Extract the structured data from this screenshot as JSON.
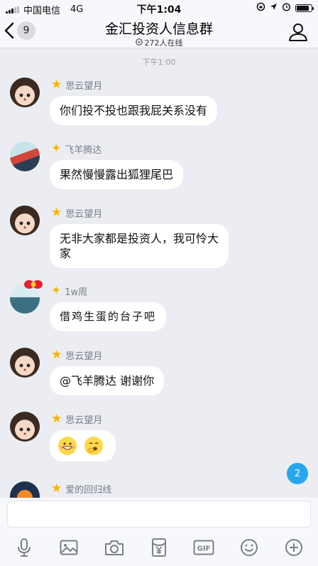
{
  "status_bar": {
    "carrier": "中国电信",
    "network": "4G",
    "time": "下午1:04",
    "battery_level": 0.85
  },
  "header": {
    "back_count": "9",
    "title": "金汇投资人信息群",
    "online": "272人在线"
  },
  "chat": {
    "timestamp": "下午1:00",
    "messages": [
      {
        "sender": "思云望月",
        "badge": "gold-star-icon",
        "text": "你们投不投也跟我屁关系没有"
      },
      {
        "sender": "飞羊腾达",
        "badge": "spark-star-icon",
        "text": "果然慢慢露出狐狸尾巴"
      },
      {
        "sender": "思云望月",
        "badge": "gold-star-icon",
        "text_line1": "无非大家都是投资人，我可怜大",
        "text_line2": "家"
      },
      {
        "sender": "1w周",
        "badge": "spark-star-icon",
        "text": "借鸡生蛋的台子吧"
      },
      {
        "sender": "思云望月",
        "badge": "gold-star-icon",
        "text": "@飞羊腾达 谢谢你"
      },
      {
        "sender": "思云望月",
        "badge": "gold-star-icon",
        "emojis": [
          "grinning-face-emoji",
          "yawning-face-emoji"
        ]
      },
      {
        "sender": "爱的回归线",
        "badge": "gold-star-icon"
      }
    ],
    "unread_count": "2"
  },
  "input": {
    "placeholder": "",
    "tools": [
      "microphone-icon",
      "image-icon",
      "camera-icon",
      "red-envelope-icon",
      "gif-icon",
      "emoji-icon",
      "plus-icon"
    ]
  },
  "colors": {
    "background": "#ebedf2",
    "bubble": "#ffffff",
    "accent_blue": "#27a6ee",
    "star": "#f7b500"
  }
}
